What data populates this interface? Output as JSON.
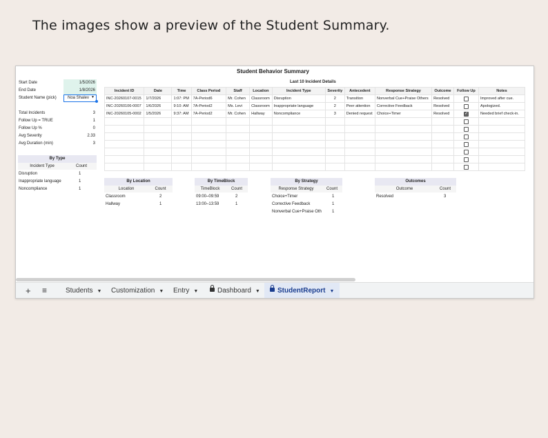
{
  "caption": "The images show a preview of the Student Summary.",
  "sheet_title": "Student Behavior Summary",
  "params": [
    {
      "label": "Start Date",
      "value": "1/5/2026"
    },
    {
      "label": "End Date",
      "value": "1/8/2026"
    },
    {
      "label": "Student Name (pick)",
      "value": "Noa Shalev"
    }
  ],
  "stats": [
    {
      "label": "Total Incidents",
      "value": "3"
    },
    {
      "label": "Follow Up = TRUE",
      "value": "1"
    },
    {
      "label": "Follow Up %",
      "value": "0"
    },
    {
      "label": "Avg Severity",
      "value": "2.33"
    },
    {
      "label": "Avg Duration (min)",
      "value": "3"
    }
  ],
  "by_type": {
    "title": "By Type",
    "headers": [
      "Incident Type",
      "Count"
    ],
    "rows": [
      [
        "Disruption",
        "1"
      ],
      [
        "Inappropriate language",
        "1"
      ],
      [
        "Noncompliance",
        "1"
      ]
    ]
  },
  "details": {
    "title": "Last 10 Incident Details",
    "headers": [
      "Incident ID",
      "Date",
      "Time",
      "Class Period",
      "Staff",
      "Location",
      "Incident Type",
      "Severity",
      "Antecedent",
      "Response Strategy",
      "Outcome",
      "Follow Up",
      "Notes"
    ],
    "rows": [
      [
        "INC-20260107-0015",
        "1/7/2026",
        "1:07: PM",
        "7A-Period6",
        "Mr. Cohen",
        "Classroom",
        "Disruption",
        "2",
        "Transition",
        "Nonverbal Cue+Praise Others",
        "Resolved",
        "",
        "Improved after cue."
      ],
      [
        "INC-20260106-0007",
        "1/6/2026",
        "9:10: AM",
        "7A-Period2",
        "Ms. Levi",
        "Classroom",
        "Inappropriate language",
        "2",
        "Peer attention",
        "Corrective Feedback",
        "Resolved",
        "",
        "Apologized."
      ],
      [
        "INC-20260105-0002",
        "1/5/2026",
        "9:37: AM",
        "7A-Period2",
        "Mr. Cohen",
        "Hallway",
        "Noncompliance",
        "3",
        "Denied request",
        "Choice+Timer",
        "Resolved",
        "",
        "Needed brief check-in."
      ]
    ],
    "follow_up": [
      false,
      false,
      true,
      false,
      false,
      false,
      false,
      false,
      false,
      false
    ]
  },
  "by_location": {
    "title": "By Location",
    "headers": [
      "Location",
      "Count"
    ],
    "rows": [
      [
        "Classroom",
        "2"
      ],
      [
        "Hallway",
        "1"
      ]
    ]
  },
  "by_timeblock": {
    "title": "By TimeBlock",
    "headers": [
      "TimeBlock",
      "Count"
    ],
    "rows": [
      [
        "09:00–09:59",
        "2"
      ],
      [
        "13:00–13:59",
        "1"
      ]
    ]
  },
  "by_strategy": {
    "title": "By Strategy",
    "headers": [
      "Response Strategy",
      "Count"
    ],
    "rows": [
      [
        "Choice+Timer",
        "1"
      ],
      [
        "Corrective Feedback",
        "1"
      ],
      [
        "Nonverbal Cue+Praise Oth",
        "1"
      ]
    ]
  },
  "outcomes": {
    "title": "Outcomes",
    "headers": [
      "Outcome",
      "Count"
    ],
    "rows": [
      [
        "Resolved",
        "3"
      ]
    ]
  },
  "tabs": [
    {
      "label": "Students",
      "locked": false,
      "active": false
    },
    {
      "label": "Customization",
      "locked": false,
      "active": false
    },
    {
      "label": "Entry",
      "locked": false,
      "active": false
    },
    {
      "label": "Dashboard",
      "locked": true,
      "active": false
    },
    {
      "label": "StudentReport",
      "locked": true,
      "active": true
    }
  ],
  "icons": {
    "add": "plus-icon",
    "menu": "menu-icon",
    "dropdown": "chevron-down-icon",
    "lock": "lock-icon"
  }
}
